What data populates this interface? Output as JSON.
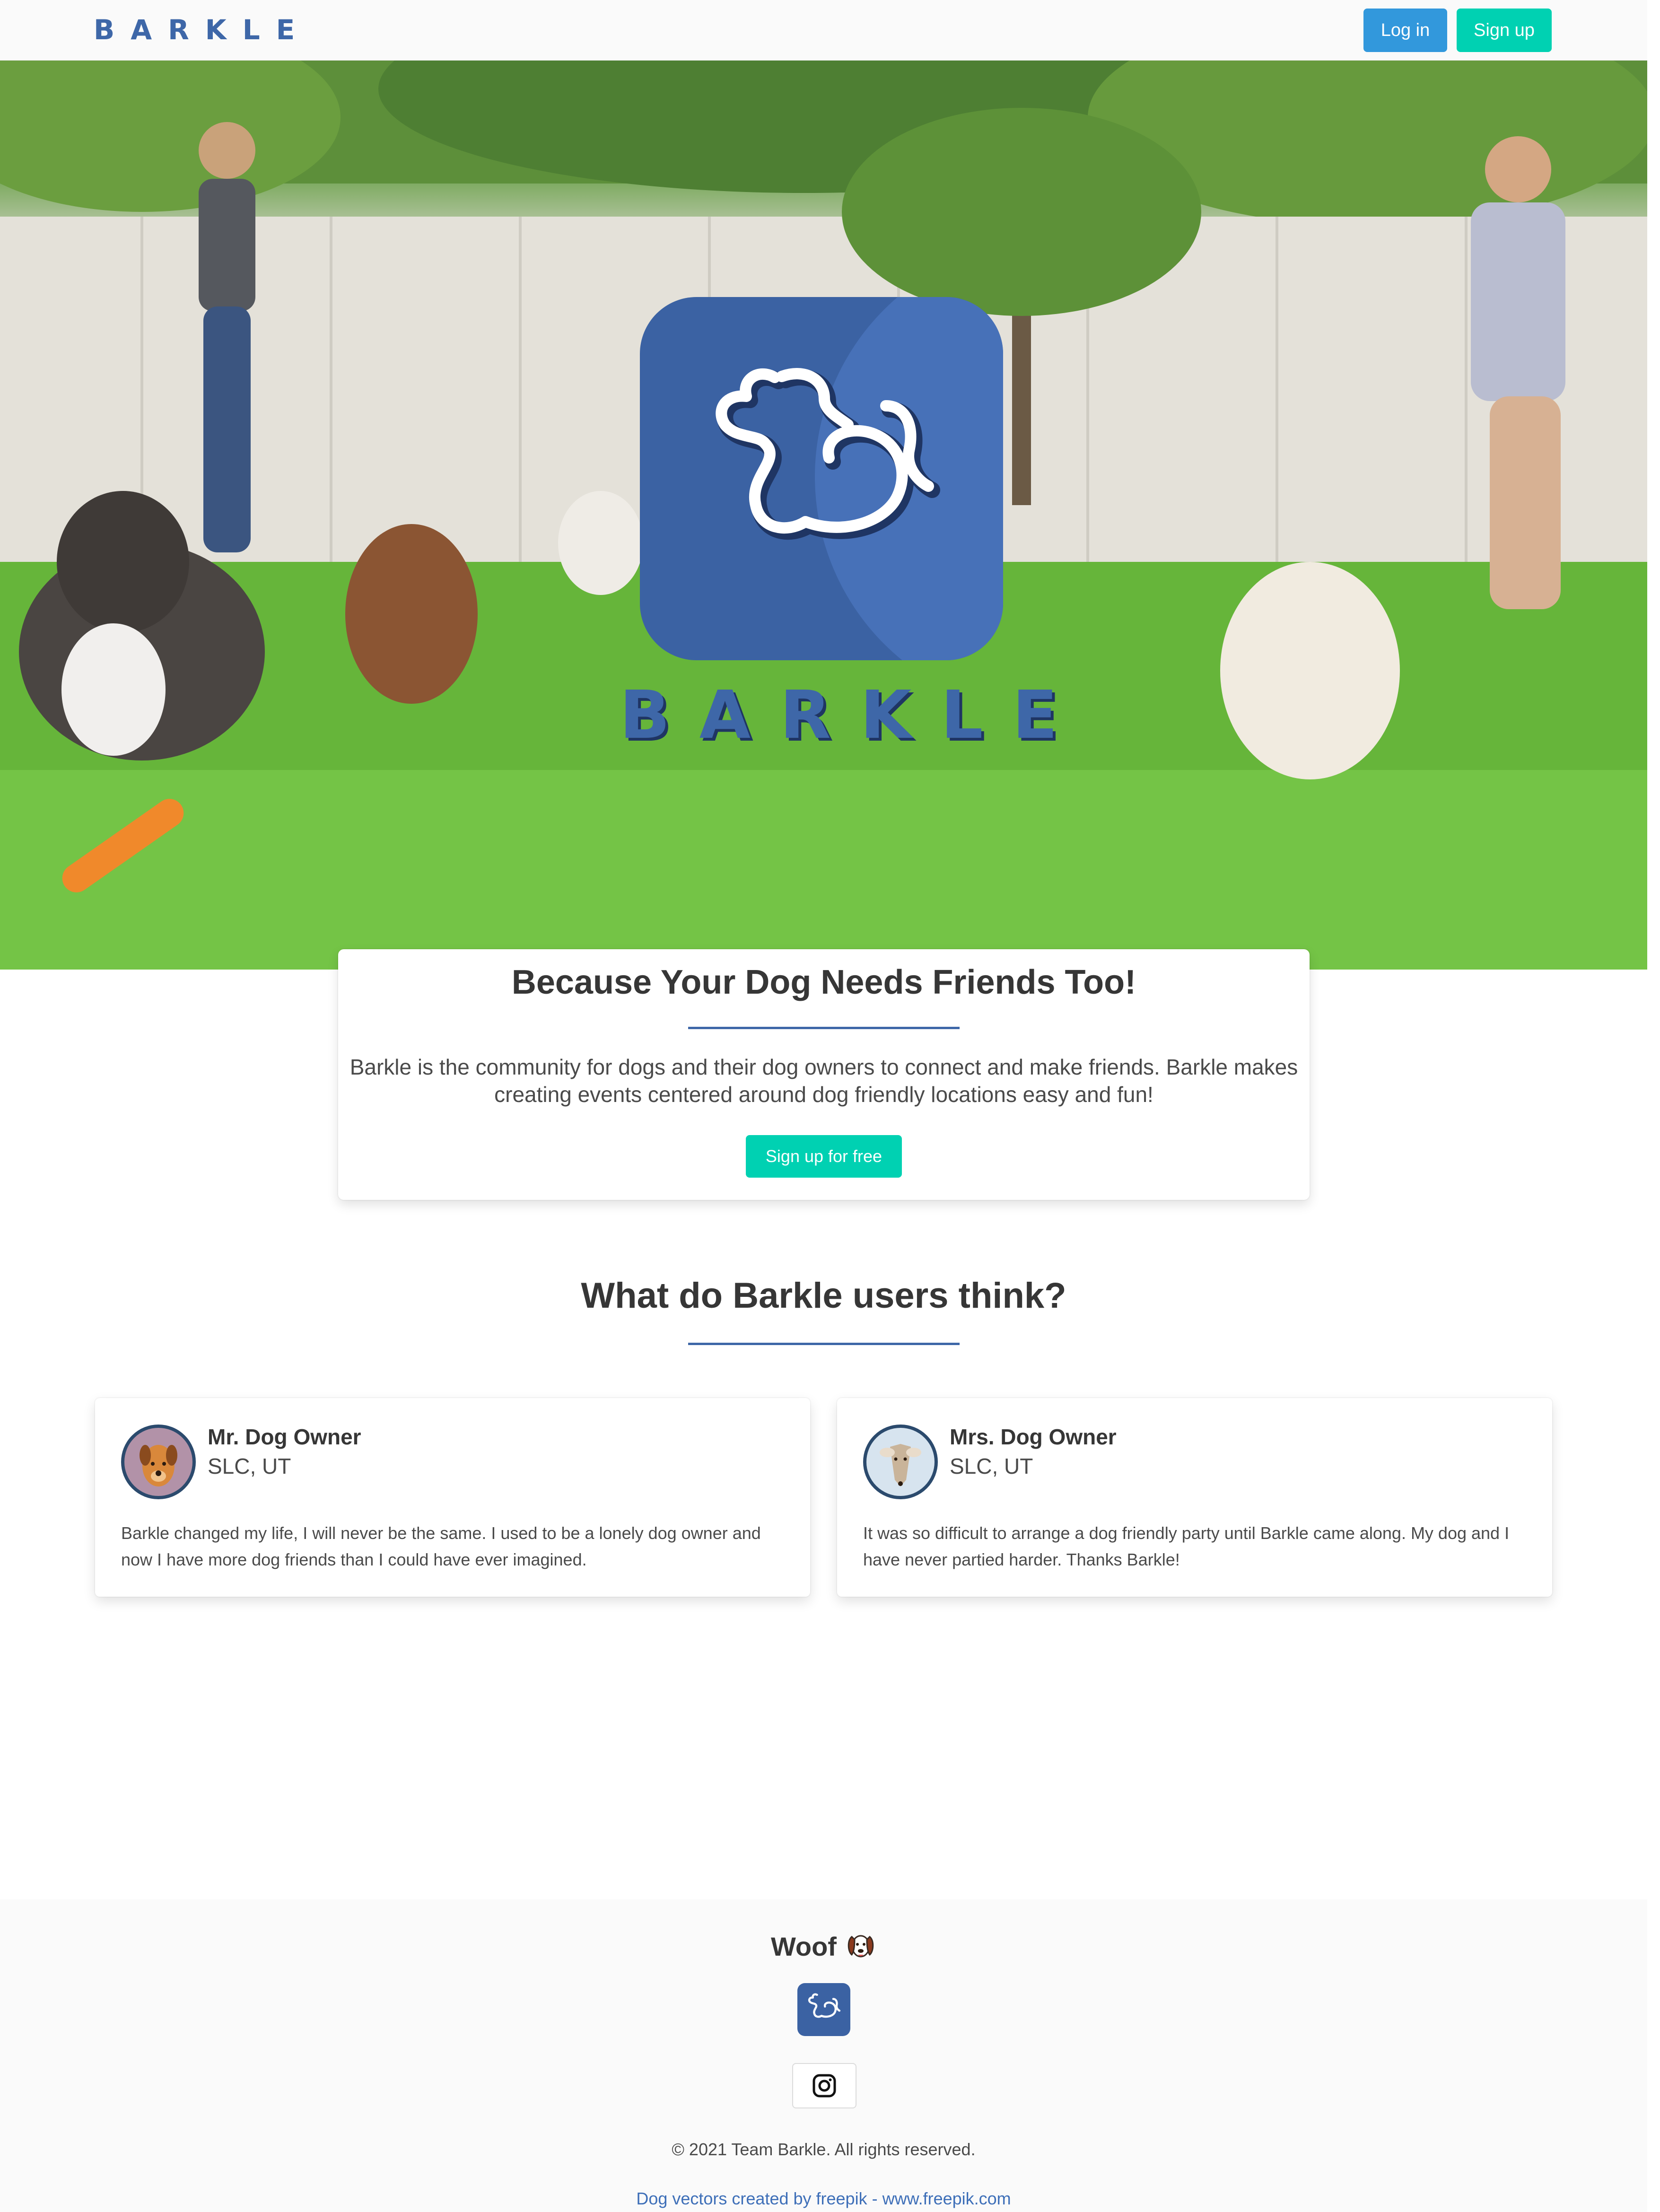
{
  "navbar": {
    "brand": "BARKLE",
    "login_label": "Log in",
    "signup_label": "Sign up"
  },
  "hero": {
    "logo_icon": "dog-logo-icon",
    "wordmark": "BARKLE",
    "background": "photo of dogs playing on grass with two women in a fenced yard"
  },
  "intro": {
    "title": "Because Your Dog Needs Friends Too!",
    "body": "Barkle is the community for dogs and their dog owners to connect and make friends. Barkle makes creating events centered around dog friendly locations easy and fun!",
    "cta_label": "Sign up for free"
  },
  "testimonials": {
    "title": "What do Barkle users think?",
    "items": [
      {
        "name": "Mr. Dog Owner",
        "location": "SLC, UT",
        "quote": "Barkle changed my life, I will never be the same. I used to be a lonely dog owner and now I have more dog friends than I could have ever imagined."
      },
      {
        "name": "Mrs. Dog Owner",
        "location": "SLC, UT",
        "quote": "It was so difficult to arrange a dog friendly party until Barkle came along. My dog and I have never partied harder. Thanks Barkle!"
      }
    ]
  },
  "footer": {
    "woof": "Woof",
    "woof_icon": "dog-face-icon",
    "logo_icon": "dog-logo-icon",
    "social_icon": "instagram-icon",
    "copyright": "© 2021 Team Barkle. All rights reserved.",
    "credit": "Dog vectors created by freepik - www.freepik.com"
  },
  "colors": {
    "brand_blue": "#3e67a8",
    "login_blue": "#3298dc",
    "signup_teal": "#00d1b2",
    "text_dark": "#363636"
  }
}
